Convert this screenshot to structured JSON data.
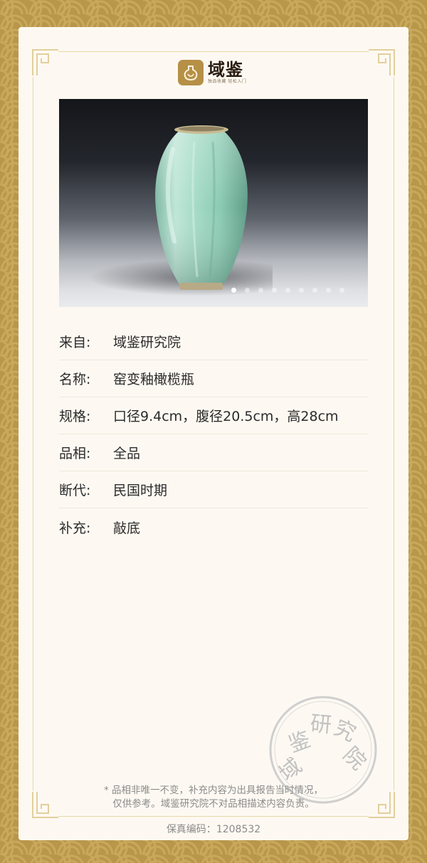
{
  "brand": {
    "name": "域鉴",
    "slogan": "独品收藏 轻松入门",
    "logo_color": "#b69047"
  },
  "photo": {
    "alt": "窑变釉橄榄瓶",
    "carousel_total": 9,
    "carousel_active": 1
  },
  "details": {
    "source": {
      "label": "来自:",
      "value": "域鉴研究院"
    },
    "name": {
      "label": "名称:",
      "value": "窑变釉橄榄瓶"
    },
    "spec": {
      "label": "规格:",
      "value": "口径9.4cm，腹径20.5cm，高28cm"
    },
    "condition": {
      "label": "品相:",
      "value": "全品"
    },
    "era": {
      "label": "断代:",
      "value": "民国时期"
    },
    "note": {
      "label": "补充:",
      "value": "敲底"
    }
  },
  "seal": {
    "text": "域鉴研究院",
    "color": "#c6c6c6"
  },
  "disclaimer": {
    "line1": "* 品相非唯一不变，补充内容为出具报告当时情况，",
    "line2": "仅供参考。域鉴研究院不对品相描述内容负责。"
  },
  "certificate": {
    "label": "保真编码：",
    "code": "1208532"
  },
  "colors": {
    "border_gold": "#b8964a",
    "card_bg": "#fdf9f2",
    "frame_line": "#e8d7a8"
  }
}
